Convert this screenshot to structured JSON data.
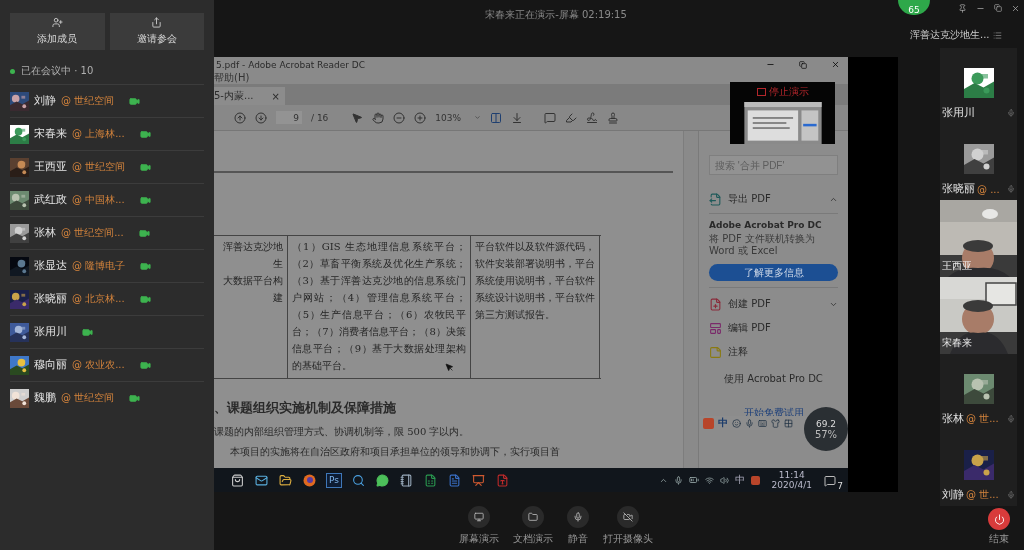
{
  "sidebar": {
    "buttons": [
      {
        "label": "添加成员"
      },
      {
        "label": "邀请参会"
      }
    ],
    "status": "已在会议中 · 10",
    "members": [
      {
        "name": "刘静",
        "org": "@ 世纪空间",
        "camera": true
      },
      {
        "name": "宋春来",
        "org": "@ 上海林...",
        "camera": true
      },
      {
        "name": "王西亚",
        "org": "@ 世纪空间",
        "camera": true
      },
      {
        "name": "武红政",
        "org": "@ 中国林...",
        "camera": true
      },
      {
        "name": "张林",
        "org": "@ 世纪空间...",
        "camera": true
      },
      {
        "name": "张显达",
        "org": "@ 隆博电子",
        "camera": true
      },
      {
        "name": "张晓丽",
        "org": "@ 北京林...",
        "camera": true
      },
      {
        "name": "张用川",
        "camera": true
      },
      {
        "name": "穆向丽",
        "org": "@ 农业农...",
        "camera": true
      },
      {
        "name": "魏鹏",
        "org": "@ 世纪空间",
        "camera": true
      }
    ]
  },
  "meeting_status": "宋春来正在演示-屏幕 02:19:15",
  "shared_screen": {
    "acrobat": {
      "title": "5.pdf - Adobe Acrobat Reader DC",
      "menu": "帮助(H)",
      "tab": "5-内蒙...",
      "tab_close": "×",
      "page": "9",
      "page_total": "/ 16",
      "zoom": "103%",
      "stop_label": "停止演示",
      "table": [
        {
          "lines": [
            "浑善达克沙地生",
            "大数据平台构建"
          ]
        },
        {
          "text": "（1）GIS 生态地理信息系统平台；（2）草畜平衡系统及优化生产系统；（3）基于浑善达克沙地的信息系统门户网站；（4）管理信息系统平台；（5）生产信息平台；（6）农牧民平台；（7）消费者信息平台；（8）决策信息平台；（9）基于大数据处理架构的基础平台。"
        },
        {
          "text": "平台软件以及软件源代码，软件安装部署说明书，平台系统使用说明书，平台软件系统设计说明书，平台软件第三方测试报告。"
        }
      ],
      "heading": "、课题组织实施机制及保障措施",
      "paragraph": "课题的内部组织管理方式、协调机制等，限 500 字以内。",
      "next_line": "本项目的实施将在自治区政府和项目承担单位的领导和协调下，实行项目首",
      "pane": {
        "search_placeholder": "搜索 '合并 PDF'",
        "export": "导出 PDF",
        "card_title": "Adobe Acrobat Pro DC",
        "card_text": "将 PDF 文件联机转换为 Word 或 Excel",
        "card_button": "了解更多信息",
        "tools": [
          {
            "label": "创建 PDF",
            "caret": true
          },
          {
            "label": "编辑 PDF",
            "caret": false
          },
          {
            "label": "注释",
            "caret": false
          }
        ],
        "promo": "使用 Acrobat Pro DC",
        "trial": "开始免费试用"
      }
    },
    "ime": {
      "label": "中"
    },
    "meter": {
      "value": "57%",
      "speed": "69.2"
    },
    "taskbar": {
      "ps": "Ps",
      "lang": "中",
      "time": "11:14",
      "date": "2020/4/1",
      "notifications": "7"
    }
  },
  "toolbar": [
    {
      "label": "屏幕演示"
    },
    {
      "label": "文档演示"
    },
    {
      "label": "静音"
    },
    {
      "label": "打开摄像头"
    }
  ],
  "badge": "65",
  "group_title": "浑善达克沙地生...",
  "tiles": [
    {
      "kind": "avatar",
      "name": "张用川"
    },
    {
      "kind": "avatar",
      "name": "张晓丽",
      "org": "@ ..."
    },
    {
      "kind": "video",
      "name": "王西亚"
    },
    {
      "kind": "video",
      "name": "宋春来"
    },
    {
      "kind": "avatar",
      "name": "张林",
      "org": "@ 世..."
    },
    {
      "kind": "avatar",
      "name": "刘静",
      "org": "@ 世..."
    }
  ],
  "leave": "结束"
}
